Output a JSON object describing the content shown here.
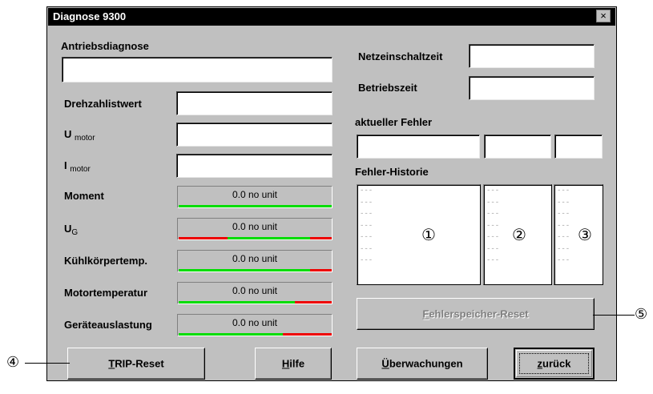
{
  "window": {
    "title": "Diagnose 9300",
    "close_glyph": "×"
  },
  "left": {
    "drive_diagnosis_label": "Antriebsdiagnose",
    "speed_actual_label": "Drehzahlistwert",
    "u_motor_label": "U",
    "u_motor_sub": "motor",
    "i_motor_label": "I",
    "i_motor_sub": "motor",
    "gauges": [
      {
        "label": "Moment",
        "label_sub": "",
        "value": "0.0 no unit"
      },
      {
        "label": "U",
        "label_sub": "G",
        "value": "0.0 no unit"
      },
      {
        "label": "Kühlkörpertemp.",
        "label_sub": "",
        "value": "0.0 no unit"
      },
      {
        "label": "Motortemperatur",
        "label_sub": "",
        "value": "0.0 no unit"
      },
      {
        "label": "Geräteauslastung",
        "label_sub": "",
        "value": "0.0 no unit"
      }
    ]
  },
  "right": {
    "power_on_time_label": "Netzeinschaltzeit",
    "operating_time_label": "Betriebszeit",
    "current_error_label": "aktueller Fehler",
    "error_history_label": "Fehler-Historie",
    "history_rows": [
      "---",
      "---",
      "---",
      "---",
      "---",
      "---",
      "---"
    ],
    "history_markers": [
      "①",
      "②",
      "③"
    ]
  },
  "buttons": {
    "trip_reset": {
      "prefix": "",
      "accel": "T",
      "rest": "RIP-Reset"
    },
    "help": {
      "prefix": "",
      "accel": "H",
      "rest": "ilfe"
    },
    "monitoring": {
      "prefix": "",
      "accel": "Ü",
      "rest": "berwachungen"
    },
    "back": {
      "prefix": "",
      "accel": "z",
      "rest": "urück"
    },
    "error_memory_reset": {
      "prefix": "",
      "accel": "F",
      "rest": "ehlerspeicher-Reset"
    }
  },
  "callouts": {
    "four": "④",
    "five": "⑤"
  },
  "colors": {
    "title_bg": "#000000",
    "dialog_bg": "#c0c0c0",
    "bar_green": "#00dd00",
    "bar_red": "#ee0000"
  }
}
